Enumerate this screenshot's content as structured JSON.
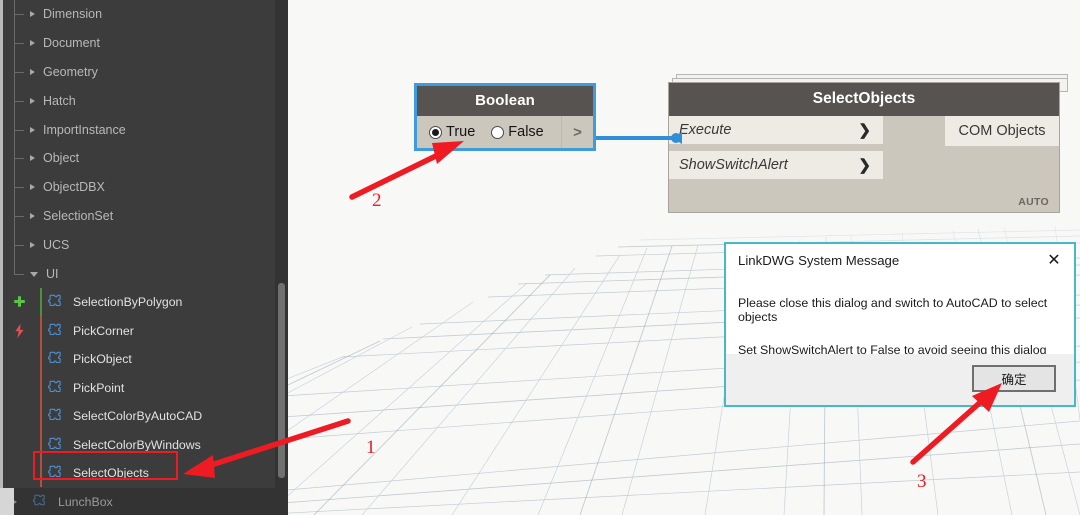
{
  "app": {
    "title": "Dynamo node library and workspace"
  },
  "library": {
    "categories": [
      {
        "label": "Dimension",
        "expanded": false
      },
      {
        "label": "Document",
        "expanded": false
      },
      {
        "label": "Geometry",
        "expanded": false
      },
      {
        "label": "Hatch",
        "expanded": false
      },
      {
        "label": "ImportInstance",
        "expanded": false
      },
      {
        "label": "Object",
        "expanded": false
      },
      {
        "label": "ObjectDBX",
        "expanded": false
      },
      {
        "label": "SelectionSet",
        "expanded": false
      },
      {
        "label": "UCS",
        "expanded": false
      },
      {
        "label": "UI",
        "expanded": true
      }
    ],
    "nodes": [
      {
        "label": "SelectionByPolygon",
        "marker": "plus-icon",
        "marker_color": "#5cc24a",
        "accent_color": "#4f8f3e"
      },
      {
        "label": "PickCorner",
        "marker": "lightning-icon",
        "marker_color": "#e2504f",
        "accent_color": "#b0503f"
      },
      {
        "label": "PickObject",
        "marker": "",
        "marker_color": "",
        "accent_color": "#b0503f"
      },
      {
        "label": "PickPoint",
        "marker": "",
        "marker_color": "",
        "accent_color": "#b0503f"
      },
      {
        "label": "SelectColorByAutoCAD",
        "marker": "",
        "marker_color": "",
        "accent_color": "#b0503f"
      },
      {
        "label": "SelectColorByWindows",
        "marker": "",
        "marker_color": "",
        "accent_color": "#b0503f"
      },
      {
        "label": "SelectObjects",
        "marker": "",
        "marker_color": "",
        "accent_color": "#b0503f"
      }
    ],
    "footer_item": {
      "label": "LunchBox",
      "expanded": false
    },
    "scrollbar_color": "#707070"
  },
  "boolean_node": {
    "title": "Boolean",
    "options": [
      {
        "label": "True",
        "selected": true
      },
      {
        "label": "False",
        "selected": false
      }
    ],
    "output_port": ">",
    "selected_border_color": "#3e9bdd"
  },
  "select_objects_node": {
    "title": "SelectObjects",
    "inputs": [
      {
        "label": "Execute",
        "chevron": "❯"
      },
      {
        "label": "ShowSwitchAlert",
        "chevron": "❯"
      }
    ],
    "outputs": [
      {
        "label": "COM Objects"
      }
    ],
    "run_mode": "AUTO"
  },
  "dialog": {
    "title": "LinkDWG System Message",
    "close_icon": "✕",
    "lines": [
      "Please close this dialog and switch to AutoCAD to select objects",
      "Set ShowSwitchAlert to False to avoid seeing this dialog again"
    ],
    "ok_button": "确定",
    "border_color": "#48b8c6"
  },
  "annotations": {
    "color": "#ee1b23",
    "callouts": [
      {
        "number": "1"
      },
      {
        "number": "2"
      },
      {
        "number": "3"
      }
    ]
  }
}
